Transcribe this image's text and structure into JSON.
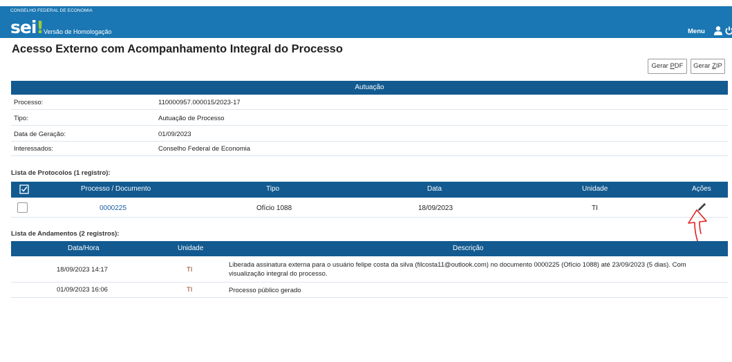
{
  "header": {
    "org": "CONSELHO FEDERAL DE ECONOMIA",
    "logo": "sei",
    "logo_mark": "!",
    "environment": "Versão de Homologação",
    "menu_label": "Menu",
    "user_icon": "user-icon",
    "power_icon": "power-icon",
    "brand_color": "#1a77b3"
  },
  "page": {
    "title": "Acesso Externo com Acompanhamento Integral do Processo",
    "buttons": {
      "pdf_pre": "Gerar ",
      "pdf_key": "P",
      "pdf_post": "DF",
      "zip_pre": "Gerar ",
      "zip_key": "Z",
      "zip_post": "IP"
    }
  },
  "autuacao": {
    "heading": "Autuação",
    "rows": [
      {
        "label": "Processo:",
        "value": "110000957.000015/2023-17"
      },
      {
        "label": "Tipo:",
        "value": "Autuação de Processo"
      },
      {
        "label": "Data de Geração:",
        "value": "01/09/2023"
      },
      {
        "label": "Interessados:",
        "value": "Conselho Federal de Economia"
      }
    ]
  },
  "protocolos": {
    "caption": "Lista de Protocolos (1 registro):",
    "columns": [
      "Processo / Documento",
      "Tipo",
      "Data",
      "Unidade",
      "Ações"
    ],
    "rows": [
      {
        "documento": "0000225",
        "tipo": "Ofício 1088",
        "data": "18/09/2023",
        "unidade": "TI",
        "acao_icon": "pencil-icon"
      }
    ]
  },
  "andamentos": {
    "caption": "Lista de Andamentos (2 registros):",
    "columns": [
      "Data/Hora",
      "Unidade",
      "Descrição"
    ],
    "rows": [
      {
        "datahora": "18/09/2023 14:17",
        "unidade": "TI",
        "descricao": "Liberada assinatura externa para o usuário felipe costa da silva (filcosta11@outlook.com) no documento 0000225 (Ofício 1088) até 23/09/2023 (5 dias). Com visualização integral do processo."
      },
      {
        "datahora": "01/09/2023 16:06",
        "unidade": "TI",
        "descricao": "Processo público gerado"
      }
    ]
  },
  "annotation": {
    "icon": "hand-drawn-arrow-icon",
    "color": "#e02020"
  }
}
